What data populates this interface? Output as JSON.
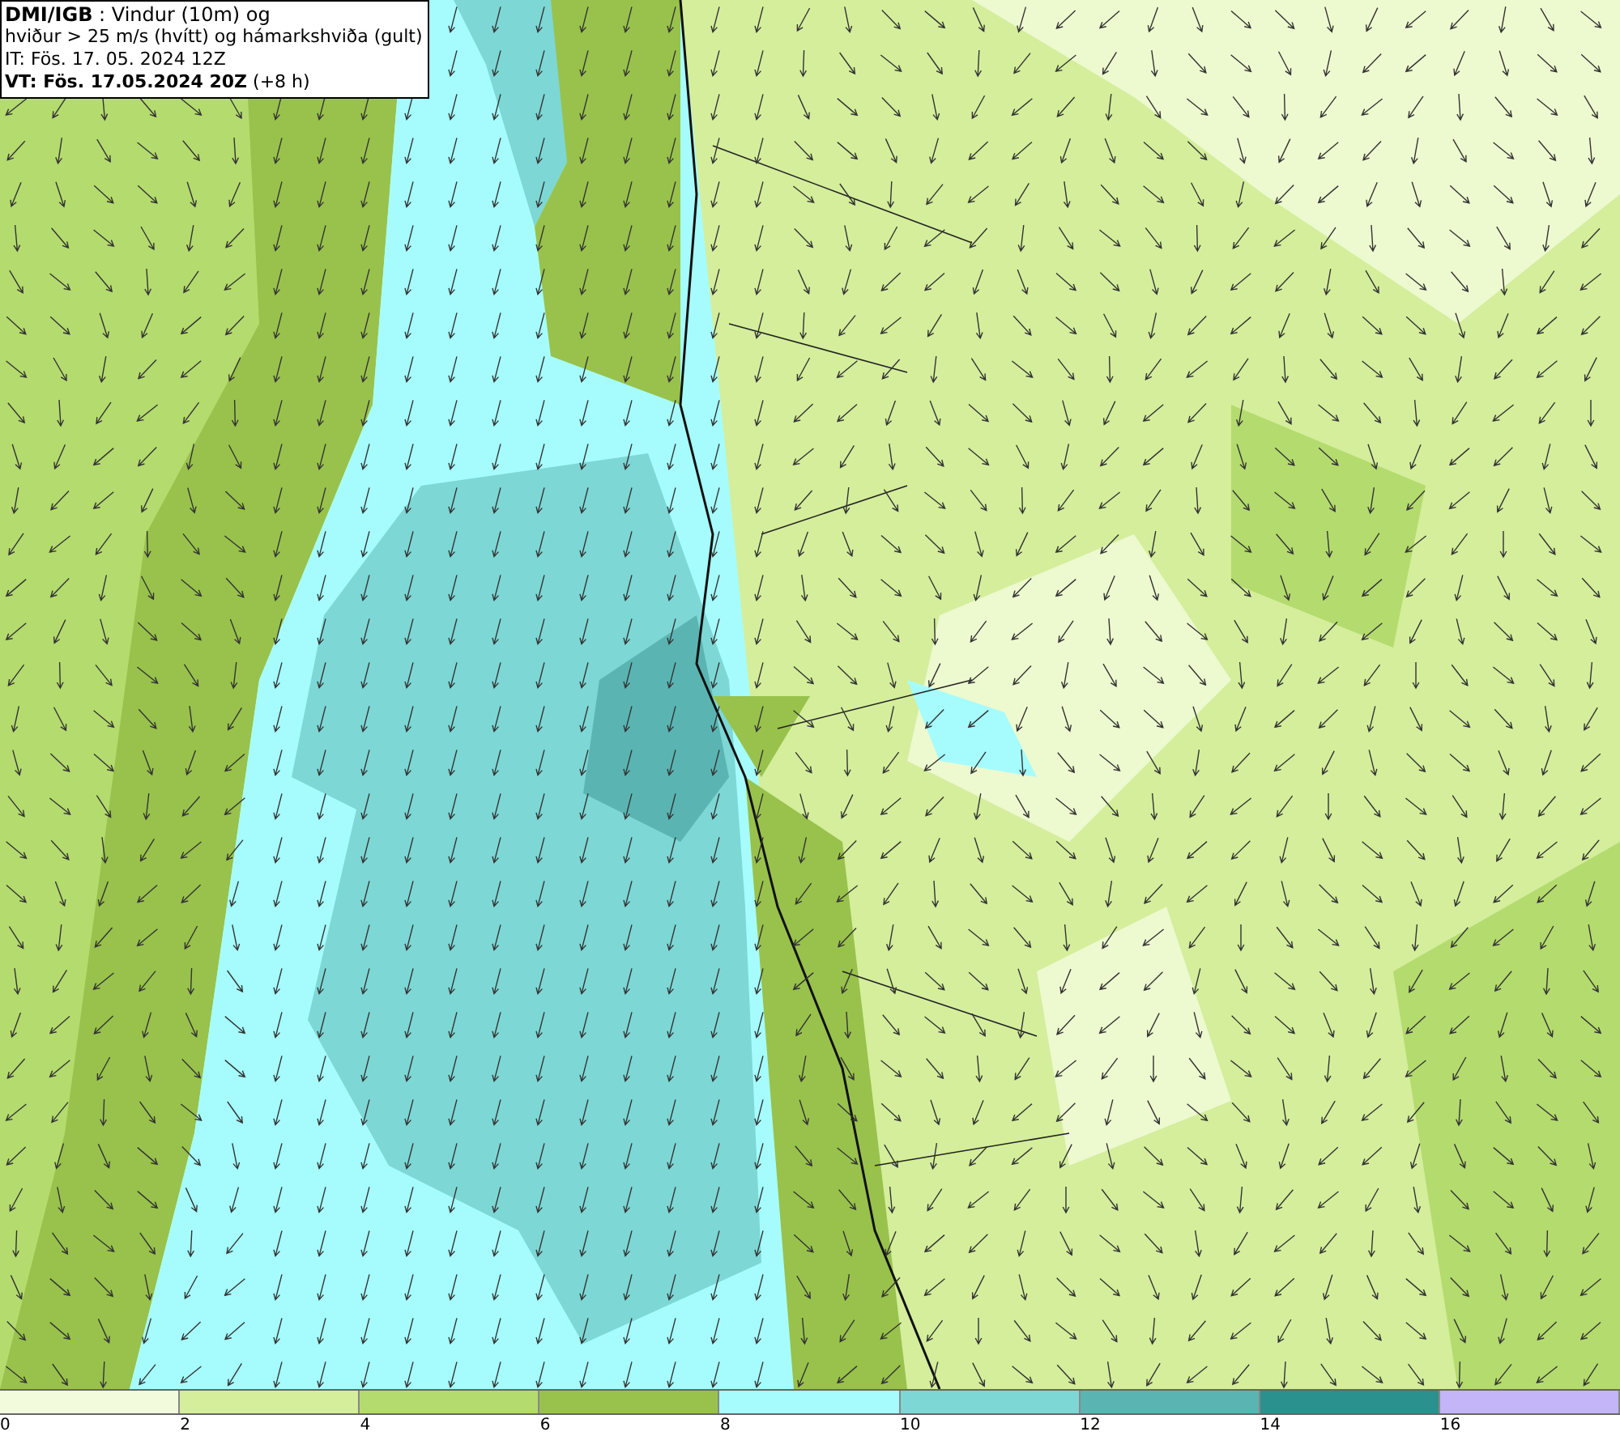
{
  "legend_box": {
    "lines": [
      "**DMI/IGB** : Vindur (10m) og",
      "hviður > 25 m/s (hvítt) og hámarkshviða (gult)",
      "IT: Fös. 17. 05. 2024 12Z",
      "**VT: Fös. 17.05.2024 20Z** (+8 h)"
    ]
  },
  "colorbar": {
    "segments": [
      {
        "label": "0",
        "color": "#f2fbdc"
      },
      {
        "label": "2",
        "color": "#d4ee9c"
      },
      {
        "label": "4",
        "color": "#b4db6e"
      },
      {
        "label": "6",
        "color": "#98c24c"
      },
      {
        "label": "8",
        "color": "#a6fcfd"
      },
      {
        "label": "10",
        "color": "#7dd7d5"
      },
      {
        "label": "12",
        "color": "#5ab5b2"
      },
      {
        "label": "14",
        "color": "#2a918e"
      },
      {
        "label": "16",
        "color": "#c4b4f8"
      }
    ]
  }
}
